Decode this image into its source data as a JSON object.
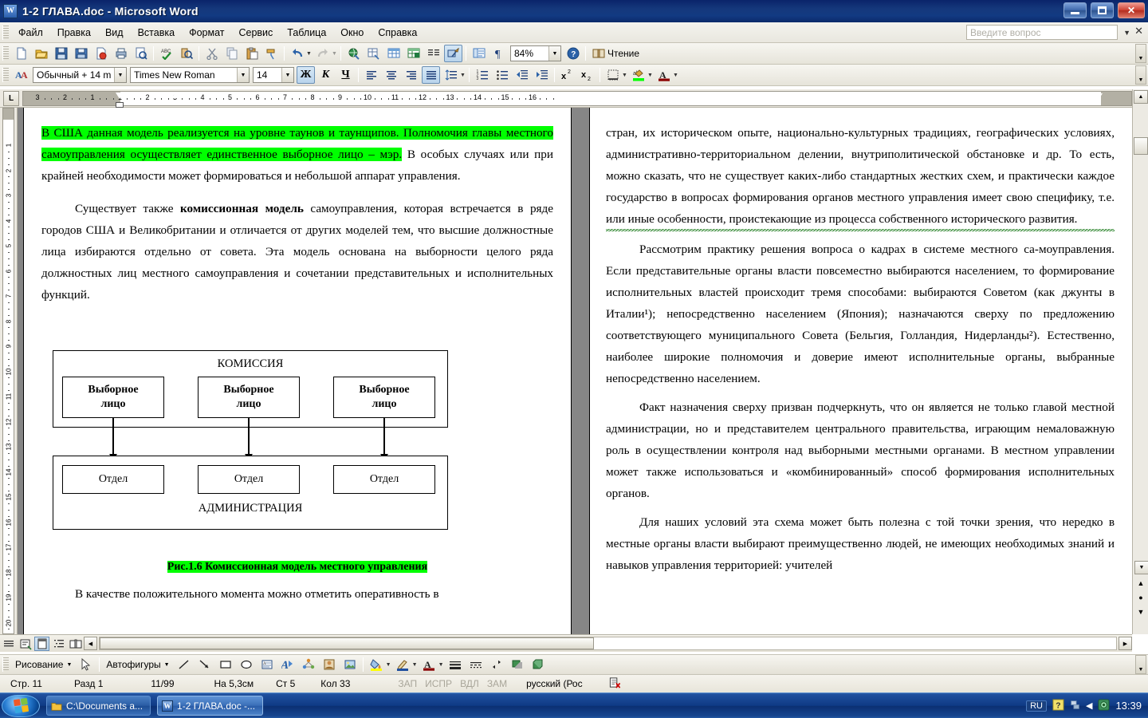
{
  "window": {
    "title": "1-2 ГЛАВА.doc - Microsoft Word",
    "app_icon": "word-document-icon",
    "minimize": "minimize-icon",
    "restore": "restore-icon",
    "close": "close-icon"
  },
  "menu": {
    "items": [
      "Файл",
      "Правка",
      "Вид",
      "Вставка",
      "Формат",
      "Сервис",
      "Таблица",
      "Окно",
      "Справка"
    ],
    "ask_placeholder": "Введите вопрос"
  },
  "toolbar_standard": {
    "zoom": "84%",
    "read_label": "Чтение",
    "buttons": [
      "new-document-icon",
      "open-folder-icon",
      "save-icon",
      "mail-recipient-icon",
      "permission-icon",
      "print-icon",
      "print-preview-icon",
      "spelling-check-icon",
      "research-icon",
      "cut-scissors-icon",
      "copy-icon",
      "paste-icon",
      "format-painter-icon",
      "undo-icon",
      "redo-icon",
      "insert-hyperlink-icon",
      "tables-and-borders-icon",
      "insert-table-icon",
      "insert-excel-worksheet-icon",
      "columns-icon",
      "drawing-icon",
      "document-map-icon",
      "show-formatting-marks-icon",
      "help-icon"
    ]
  },
  "toolbar_formatting": {
    "style": "Обычный + 14 m",
    "font": "Times New Roman",
    "size": "14",
    "bold": "Ж",
    "italic": "К",
    "underline": "Ч",
    "buttons": [
      "align-left-icon",
      "align-center-icon",
      "align-right-icon",
      "align-justify-icon",
      "line-spacing-icon",
      "numbered-list-icon",
      "bulleted-list-icon",
      "decrease-indent-icon",
      "increase-indent-icon",
      "superscript-icon",
      "subscript-icon",
      "borders-icon",
      "highlight-color-icon",
      "font-color-icon"
    ]
  },
  "ruler": {
    "tab_selector": "L",
    "h_numbers": [
      "3",
      "2",
      "1",
      "1",
      "2",
      "3",
      "4",
      "5",
      "6",
      "7",
      "8",
      "9",
      "10",
      "11",
      "12",
      "13",
      "14",
      "15",
      "16"
    ],
    "v_numbers": [
      "1",
      "2",
      "3",
      "4",
      "5",
      "6",
      "7",
      "8",
      "9",
      "10",
      "11",
      "12",
      "13",
      "14",
      "15",
      "16",
      "17",
      "18",
      "19",
      "20"
    ]
  },
  "document": {
    "left_page": {
      "p1": {
        "hl1": "В США данная модель реализуется на уровне таунов и таунщипов. Полномочия главы местного самоуправления осуществляет единственное выборное лицо – мэр.",
        "rest": " В особых случаях или при крайней необходимости может формироваться и небольшой аппарат управления."
      },
      "p2": {
        "a": "Существует также ",
        "b": "комиссионная модель",
        "c": " самоуправления, которая встречается в ряде городов США и Великобритании и отличается от других моделей тем, что высшие должностные лица избираются отдельно от совета. Эта модель основана на выборности целого ряда должностных лиц местного самоуправления и сочетании представительных и исполнительных функций."
      },
      "figure": {
        "top_title": "КОМИССИЯ",
        "bottom_title": "АДМИНИСТРАЦИЯ",
        "elected": [
          "Выборное\nлицо",
          "Выборное\nлицо",
          "Выборное\nлицо"
        ],
        "departments": [
          "Отдел",
          "Отдел",
          "Отдел"
        ],
        "caption": "Рис.1.6 Комиссионная модель местного управления"
      },
      "p3": "В качестве положительного момента можно отметить оперативность в"
    },
    "right_page": {
      "p1": "стран, их историческом опыте, национально-культурных традициях, географических условиях, административно-территориальном делении, внутриполитической обстановке и др. То есть, можно сказать, что не существует каких-либо стандартных жестких схем, и практически каждое государство в вопросах формирования органов местного управления имеет свою специфику, т.е. или иные особенности, проистекающие из процесса собственного исторического развития.",
      "p2": "Рассмотрим практику решения вопроса о кадрах в системе местного са-моуправления. Если представительные органы власти повсеместно выбираются населением, то формирование исполнительных властей происходит тремя способами: выбираются Советом (как джунты в Италии¹); непосредственно населением (Япония); назначаются сверху по предложению соответствующего муниципального Совета (Бельгия, Голландия, Нидерланды²). Естественно, наиболее широкие полномочия и доверие имеют исполнительные органы, выбранные непосредственно населением.",
      "p3": "Факт назначения сверху призван подчеркнуть, что он является не только главой местной администрации, но и представителем центрального правительства, играющим немаловажную роль в осуществлении контроля над выборными местными органами. В местном управлении может также использоваться и «комбинированный» способ формирования исполнительных органов.",
      "p4": "Для наших условий эта схема может быть полезна с той точки зрения, что нередко в местные органы власти выбирают преимущественно людей, не имеющих необходимых знаний и навыков управления территорией: учителей"
    }
  },
  "drawing_toolbar": {
    "draw_label": "Рисование",
    "autoshapes_label": "Автофигуры",
    "buttons": [
      "select-arrow-icon",
      "line-icon",
      "arrow-icon",
      "rectangle-icon",
      "oval-icon",
      "text-box-icon",
      "wordart-icon",
      "diagram-icon",
      "clip-art-icon",
      "picture-icon",
      "fill-color-icon",
      "line-color-icon",
      "font-color-icon",
      "line-style-icon",
      "dash-style-icon",
      "arrow-style-icon",
      "shadow-style-icon",
      "3d-style-icon"
    ]
  },
  "status_bar": {
    "page": "Стр. 11",
    "section": "Разд 1",
    "page_of": "11/99",
    "at": "На 5,3см",
    "line": "Ст 5",
    "col": "Кол 33",
    "rec": "ЗАП",
    "trk": "ИСПР",
    "ext": "ВДЛ",
    "ovr": "ЗАМ",
    "language": "русский (Рос",
    "spell_icon": "spelling-status-icon"
  },
  "taskbar": {
    "start": "start-orb-icon",
    "items": [
      {
        "label": "C:\\Documents a...",
        "icon": "folder-icon",
        "active": false
      },
      {
        "label": "1-2 ГЛАВА.doc -...",
        "icon": "word-document-icon",
        "active": true
      }
    ],
    "tray": {
      "language": "RU",
      "help_icon": "help-tray-icon",
      "network_icon": "network-tray-icon",
      "show_hidden_icon": "chevron-left-icon",
      "shield_icon": "security-tray-icon",
      "clock": "13:39"
    }
  },
  "colors": {
    "highlight": "#00ff00",
    "titlebar": "#0a246a",
    "taskbar": "#0f3a85",
    "page_bg": "#868686",
    "spellcheck_green": "#1a7a1a"
  }
}
